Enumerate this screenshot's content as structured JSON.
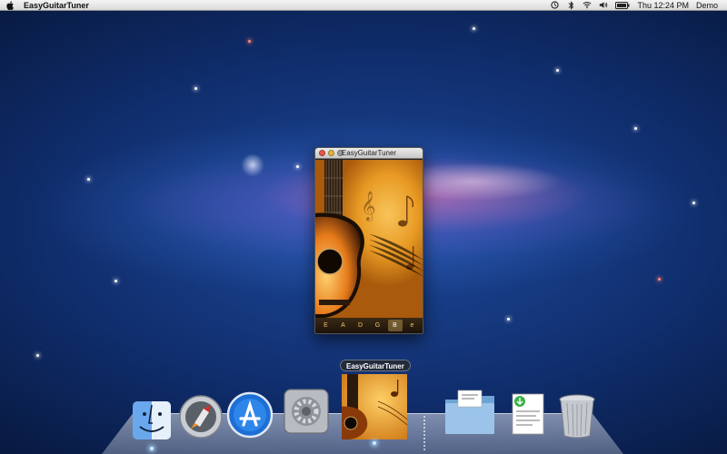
{
  "menubar": {
    "apple_icon": "apple-icon",
    "app_name": "EasyGuitarTuner",
    "clock": "Thu 12:24 PM",
    "user": "Demo",
    "status_icons": [
      "time-machine-icon",
      "bluetooth-icon",
      "wifi-icon",
      "volume-icon",
      "battery-icon"
    ]
  },
  "window": {
    "title": "EasyGuitarTuner",
    "strings": [
      "E",
      "A",
      "D",
      "G",
      "B",
      "e"
    ],
    "selected_string": "B"
  },
  "dock": {
    "tooltip": "EasyGuitarTuner",
    "items": [
      {
        "name": "Finder",
        "icon": "finder-icon",
        "running": true
      },
      {
        "name": "Launchpad",
        "icon": "launchpad-icon",
        "running": false
      },
      {
        "name": "App Store",
        "icon": "app-store-icon",
        "running": false
      },
      {
        "name": "System Preferences",
        "icon": "system-preferences-icon",
        "running": false
      },
      {
        "name": "EasyGuitarTuner",
        "icon": "easyguitartuner-icon",
        "running": true
      },
      {
        "name": "Applications",
        "icon": "applications-folder-icon",
        "running": false
      },
      {
        "name": "Downloads",
        "icon": "downloads-stack-icon",
        "running": false
      },
      {
        "name": "Trash",
        "icon": "trash-icon",
        "running": false
      }
    ]
  }
}
